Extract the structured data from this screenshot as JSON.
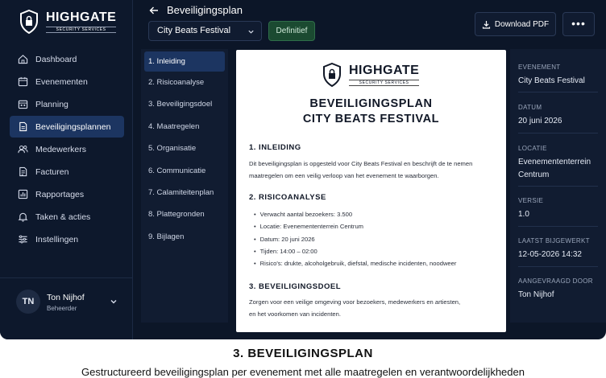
{
  "brand": {
    "name": "HIGHGATE",
    "tagline": "SECURITY SERVICES"
  },
  "sidebar": {
    "items": [
      {
        "label": "Dashboard",
        "icon": "home-icon"
      },
      {
        "label": "Evenementen",
        "icon": "calendar-icon"
      },
      {
        "label": "Planning",
        "icon": "calendar-grid-icon"
      },
      {
        "label": "Beveiligingsplannen",
        "icon": "document-icon",
        "active": true
      },
      {
        "label": "Medewerkers",
        "icon": "users-icon"
      },
      {
        "label": "Facturen",
        "icon": "invoice-icon"
      },
      {
        "label": "Rapportages",
        "icon": "chart-icon"
      },
      {
        "label": "Taken & acties",
        "icon": "bell-icon"
      },
      {
        "label": "Instellingen",
        "icon": "sliders-icon"
      }
    ]
  },
  "user": {
    "initials": "TN",
    "name": "Ton Nijhof",
    "role": "Beheerder"
  },
  "header": {
    "title": "Beveiligingsplan",
    "event_select": "City Beats Festival",
    "status": "Definitief",
    "download_label": "Download PDF",
    "more_label": "•••"
  },
  "toc": [
    "1. Inleiding",
    "2. Risicoanalyse",
    "3. Beveiligingsdoel",
    "4. Maatregelen",
    "5. Organisatie",
    "6. Communicatie",
    "7. Calamiteitenplan",
    "8. Plattegronden",
    "9. Bijlagen"
  ],
  "document": {
    "title_line1": "BEVEILIGINGSPLAN",
    "title_line2": "CITY BEATS FESTIVAL",
    "s1_heading": "1.   INLEIDING",
    "s1_line1": "Dit beveiligingsplan is opgesteld voor City Beats Festival en beschrijft de te nemen",
    "s1_line2": "maatregelen om een veilig verloop van het evenement te waarborgen.",
    "s2_heading": "2.   RISICOANALYSE",
    "s2_bullets": [
      "Verwacht aantal bezoekers: 3.500",
      "Locatie: Evenemententerrein Centrum",
      "Datum: 20 juni 2026",
      "Tijden: 14:00 – 02:00",
      "Risico's: drukte, alcoholgebruik, diefstal, medische incidenten, noodweer"
    ],
    "s3_heading": "3.   BEVEILIGINGSDOEL",
    "s3_line1": "Zorgen voor een veilige omgeving voor bezoekers, medewerkers en artiesten,",
    "s3_line2": "en het voorkomen van incidenten."
  },
  "meta": {
    "event_label": "EVENEMENT",
    "event_value": "City Beats Festival",
    "date_label": "DATUM",
    "date_value": "20 juni 2026",
    "location_label": "LOCATIE",
    "location_value": "Evenemententerrein Centrum",
    "version_label": "VERSIE",
    "version_value": "1.0",
    "updated_label": "LAATST BIJGEWERKT",
    "updated_value": "12-05-2026  14:32",
    "requested_label": "AANGEVRAAGD DOOR",
    "requested_value": "Ton Nijhof"
  },
  "caption": {
    "title": "3. BEVEILIGINGSPLAN",
    "subtitle": "Gestructureerd beveiligingsplan per evenement met alle maatregelen en verantwoordelijkheden"
  }
}
